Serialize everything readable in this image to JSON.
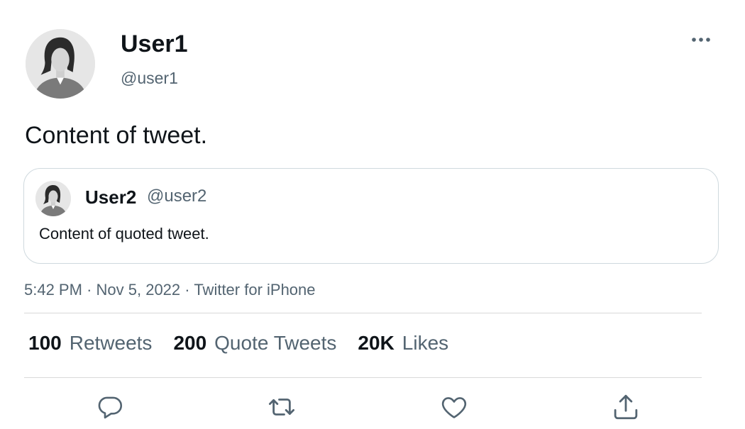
{
  "tweet": {
    "author": {
      "display_name": "User1",
      "handle": "@user1",
      "avatar_icon": "default-female-avatar"
    },
    "text": "Content of tweet.",
    "more_icon": "more-horizontal-icon",
    "quoted": {
      "display_name": "User2",
      "handle": "@user2",
      "avatar_icon": "default-female-avatar",
      "text": "Content of quoted tweet."
    },
    "meta": {
      "time": "5:42 PM",
      "separator": "·",
      "date": "Nov 5, 2022",
      "source": "Twitter for iPhone"
    },
    "stats": {
      "retweets_count": "100",
      "retweets_label": "Retweets",
      "quotes_count": "200",
      "quotes_label": "Quote Tweets",
      "likes_count": "20K",
      "likes_label": "Likes"
    },
    "actions": [
      "reply-icon",
      "retweet-icon",
      "like-icon",
      "share-icon"
    ]
  },
  "colors": {
    "primary_text": "#0f1419",
    "secondary_text": "#536471",
    "border": "#cfd9de",
    "divider": "#d9d9d9",
    "avatar_bg": "#e6e6e6"
  }
}
